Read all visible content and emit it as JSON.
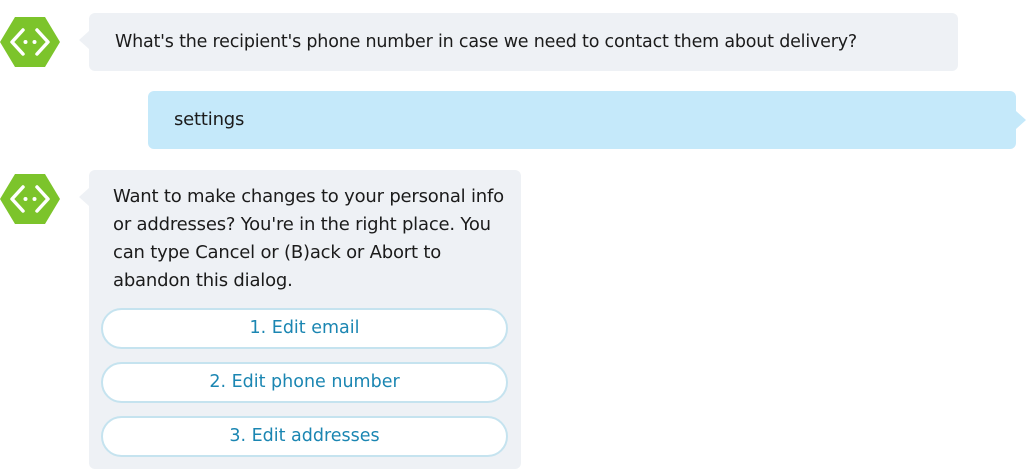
{
  "conversation": {
    "messages": [
      {
        "sender": "bot",
        "text": "What's the recipient's phone number in case we need to contact them about delivery?"
      },
      {
        "sender": "user",
        "text": "settings"
      },
      {
        "sender": "bot",
        "text": "Want to make changes to your personal info or addresses? You're in the right place. You can type Cancel or (B)ack or Abort to abandon this dialog.",
        "actions": [
          "1. Edit email",
          "2. Edit phone number",
          "3. Edit addresses"
        ]
      }
    ]
  },
  "colors": {
    "bot_avatar_green": "#7cc42b",
    "bot_bubble": "#eef1f5",
    "user_bubble": "#c5e9fa",
    "action_text": "#1b86b2",
    "action_border": "#c5e3ef"
  },
  "icons": {
    "bot_avatar": "bot-avatar-icon"
  }
}
